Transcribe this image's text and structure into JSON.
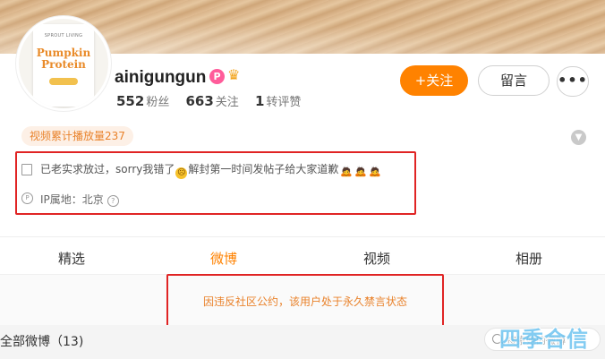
{
  "profile": {
    "username": "ainigungun",
    "badge_p": "P",
    "stats": [
      {
        "num": "552",
        "label": "粉丝"
      },
      {
        "num": "663",
        "label": "关注"
      },
      {
        "num": "1",
        "label": "转评赞"
      }
    ]
  },
  "avatar": {
    "brand": "SPROUT LIVING",
    "product_line1": "Pumpkin",
    "product_line2": "Protein"
  },
  "actions": {
    "follow_label": "+关注",
    "message_label": "留言",
    "more_label": "•••"
  },
  "video_stat": "视频累计播放量237",
  "bio": {
    "text_prefix": "已老实求放过，sorry我错了",
    "text_suffix": "解封第一时间发帖子给大家道歉",
    "ip_label": "IP属地：北京"
  },
  "tabs": [
    {
      "label": "精选"
    },
    {
      "label": "微博",
      "active": true
    },
    {
      "label": "视频"
    },
    {
      "label": "相册"
    }
  ],
  "notice": "因违反社区公约，该用户处于永久禁言状态",
  "feed": {
    "all_weibo_label": "全部微博（13)",
    "search_placeholder": "搜索她的微博"
  },
  "watermark": "四季合信",
  "colors": {
    "accent": "#ff8200",
    "notice": "#e9822b",
    "highlight": "#e02424"
  }
}
